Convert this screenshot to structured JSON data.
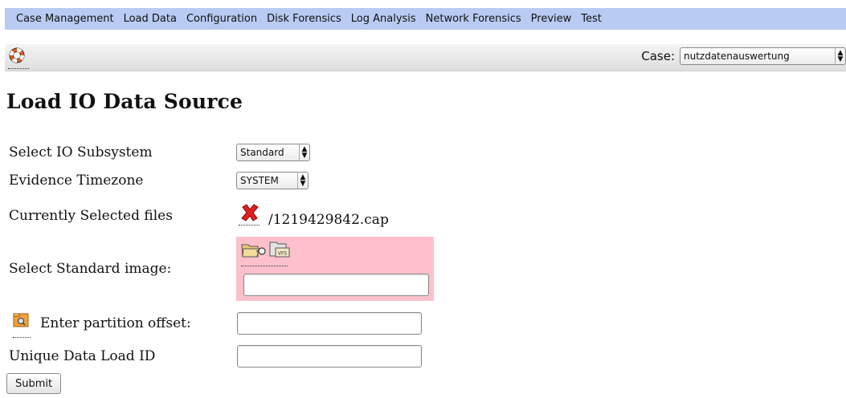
{
  "menu": {
    "items": [
      "Case Management",
      "Load Data",
      "Configuration",
      "Disk Forensics",
      "Log Analysis",
      "Network Forensics",
      "Preview",
      "Test"
    ]
  },
  "toolbar": {
    "help_icon": "lifebuoy-icon",
    "case_label": "Case:",
    "case_value": "nutzdatenauswertung"
  },
  "page": {
    "title": "Load IO Data Source"
  },
  "form": {
    "io_subsystem": {
      "label": "Select IO Subsystem",
      "value": "Standard"
    },
    "timezone": {
      "label": "Evidence Timezone",
      "value": "SYSTEM"
    },
    "selected_files": {
      "label": "Currently Selected files",
      "file": "/1219429842.cap",
      "remove_icon": "red-x-icon"
    },
    "standard_image": {
      "label": "Select Standard image:",
      "value": "",
      "icons": [
        "folder-open-icon",
        "vfs-folder-icon"
      ]
    },
    "partition_offset": {
      "label": "Enter partition offset:",
      "value": "",
      "icon": "partition-search-icon"
    },
    "load_id": {
      "label": "Unique Data Load ID",
      "value": ""
    },
    "submit_label": "Submit"
  },
  "colors": {
    "menubar_bg": "#b9cbf2",
    "highlight_bg": "#ffc0cb"
  }
}
